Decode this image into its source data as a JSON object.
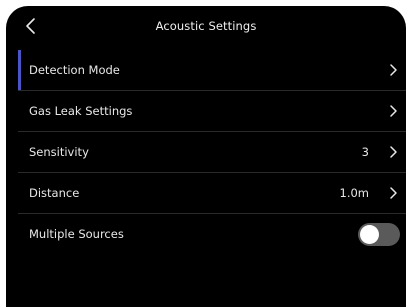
{
  "header": {
    "title": "Acoustic Settings",
    "back_icon": "chevron-left-icon"
  },
  "settings": {
    "items": [
      {
        "label": "Detection Mode",
        "value": "",
        "icon": "chevron-right-icon"
      },
      {
        "label": "Gas Leak Settings",
        "value": "",
        "icon": "chevron-right-icon"
      },
      {
        "label": "Sensitivity",
        "value": "3",
        "icon": "chevron-right-icon"
      },
      {
        "label": "Distance",
        "value": "1.0m",
        "icon": "chevron-right-icon"
      },
      {
        "label": "Multiple Sources",
        "toggle_on": false
      }
    ]
  },
  "colors": {
    "background": "#000000",
    "accent": "#4a55c7",
    "toggle_off": "#5a5a5a"
  }
}
